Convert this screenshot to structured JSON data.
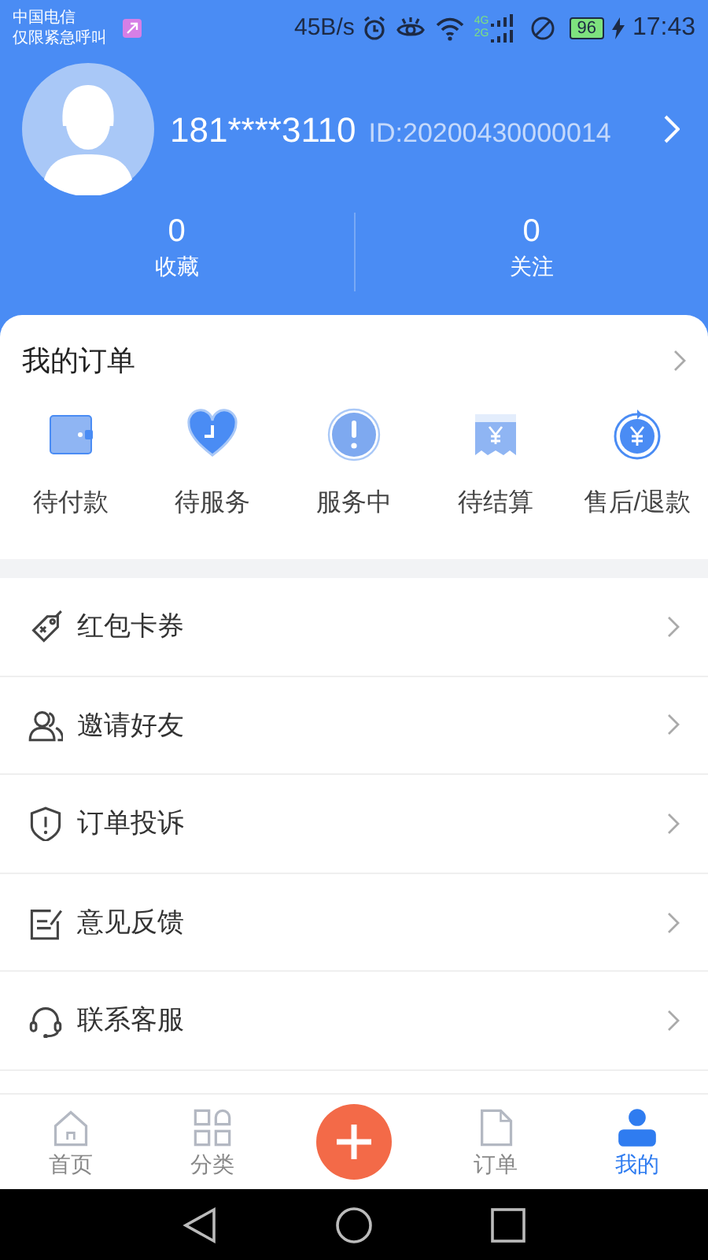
{
  "status_bar": {
    "carrier": [
      "中国电信",
      "仅限紧急呼叫"
    ],
    "net_speed": "45B/s",
    "network_labels": [
      "4G",
      "2G"
    ],
    "battery": "96",
    "time": "17:43"
  },
  "profile": {
    "phone": "181****3110",
    "id": "ID:20200430000014",
    "stats": [
      {
        "value": "0",
        "label": "收藏"
      },
      {
        "value": "0",
        "label": "关注"
      }
    ]
  },
  "orders": {
    "title": "我的订单",
    "items": [
      {
        "label": "待付款"
      },
      {
        "label": "待服务"
      },
      {
        "label": "服务中"
      },
      {
        "label": "待结算"
      },
      {
        "label": "售后/退款"
      }
    ]
  },
  "menu": [
    {
      "label": "红包卡券"
    },
    {
      "label": "邀请好友"
    },
    {
      "label": "订单投诉"
    },
    {
      "label": "意见反馈"
    },
    {
      "label": "联系客服"
    }
  ],
  "tab_bar": [
    {
      "label": "首页",
      "selected": false
    },
    {
      "label": "分类",
      "selected": false
    },
    {
      "label": "订单",
      "selected": false
    },
    {
      "label": "我的",
      "selected": true
    }
  ]
}
